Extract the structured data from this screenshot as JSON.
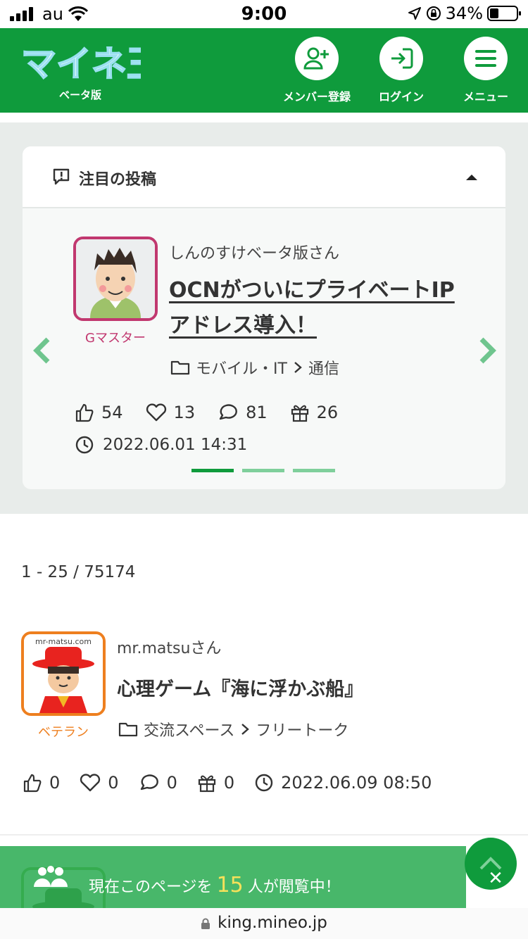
{
  "status_bar": {
    "carrier": "au",
    "time": "9:00",
    "battery": "34%"
  },
  "header": {
    "logo_text": "マイネ王",
    "logo_sub": "ベータ版",
    "buttons": [
      {
        "label": "メンバー登録",
        "icon": "add-user-icon"
      },
      {
        "label": "ログイン",
        "icon": "login-icon"
      },
      {
        "label": "メニュー",
        "icon": "menu-icon"
      }
    ]
  },
  "featured": {
    "title": "注目の投稿",
    "author": "しんのすけベータ版さん",
    "rank": "Gマスター",
    "post_title": "OCNがついにプライベートIPアドレス導入！",
    "category": "モバイル・IT",
    "subcategory": "通信",
    "likes": "54",
    "hearts": "13",
    "comments": "81",
    "gifts": "26",
    "date": "2022.06.01 14:31",
    "slide_index": 1,
    "slide_count": 3
  },
  "list": {
    "count": "1 - 25 / 75174",
    "items": [
      {
        "author": "mr.matsuさん",
        "avatar_caption": "mr-matsu.com",
        "rank": "ベテラン",
        "title": "心理ゲーム『海に浮かぶ船』",
        "category": "交流スペース",
        "subcategory": "フリートーク",
        "likes": "0",
        "hearts": "0",
        "comments": "0",
        "gifts": "0",
        "date": "2022.06.09 08:50"
      }
    ]
  },
  "banner": {
    "prefix": "現在このページを",
    "count": "15",
    "suffix": "人が閲覧中！"
  },
  "url_bar": {
    "url": "king.mineo.jp"
  },
  "colors": {
    "brand_green": "#0f9b3c",
    "rank_gmaster": "#c1386f",
    "rank_veteran": "#ee7f1f",
    "banner_count": "#f5e15a"
  }
}
